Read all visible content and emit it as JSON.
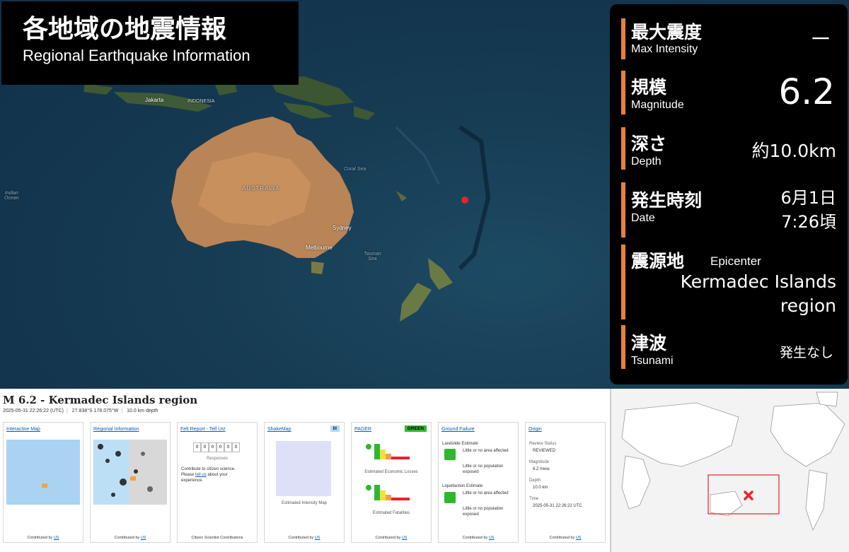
{
  "header": {
    "title_jp": "各地域の地震情報",
    "title_en": "Regional Earthquake Information"
  },
  "map_labels": {
    "jakarta": "Jakarta",
    "indonesia": "INDONESIA",
    "australia": "AUSTRALIA",
    "sydney": "Sydney",
    "melbourne": "Melbourne",
    "indian_ocean": "Indian\nOcean",
    "coral_sea": "Coral Sea",
    "tasman_sea": "Tasman\nSea"
  },
  "info": {
    "intensity": {
      "jp": "最大震度",
      "en": "Max  Intensity",
      "value": "－"
    },
    "magnitude": {
      "jp": "規模",
      "en": "Magnitude",
      "value": "6.2"
    },
    "depth": {
      "jp": "深さ",
      "en": "Depth",
      "value": "約10.0km"
    },
    "date": {
      "jp": "発生時刻",
      "en": "Date",
      "value_line1": "6月1日",
      "value_line2": "7:26頃"
    },
    "epicenter": {
      "jp": "震源地",
      "en": "Epicenter",
      "value_line1": "Kermadec Islands",
      "value_line2": "region"
    },
    "tsunami": {
      "jp": "津波",
      "en": "Tsunami",
      "value": "発生なし"
    }
  },
  "usgs": {
    "title": "M 6.2 - Kermadec Islands region",
    "time": "2025-05-31 22:26:22 (UTC)",
    "location": "27.838°S 178.075°W",
    "depth": "10.0 km depth",
    "contributed_by": "Contributed by",
    "us": "US",
    "cards": {
      "interactive_map": "Interactive Map",
      "regional_info": "Regional Information",
      "felt_report": "Felt Report - Tell Us!",
      "felt_counter": [
        "0",
        "0",
        "0",
        "0",
        "0",
        "0"
      ],
      "responses": "Responses",
      "felt_text_1": "Contribute to citizen science.",
      "felt_text_2": "Please",
      "felt_link": "tell us",
      "felt_text_3": "about your",
      "felt_text_4": "experience.",
      "felt_footer": "Citizen Scientist Contributions",
      "shakemap": "ShakeMap",
      "shakemap_badge": "III",
      "shakemap_caption": "Estimated Intensity Map",
      "pager": "PAGER",
      "pager_badge": "GREEN",
      "pager_econ": "Estimated Economic Losses",
      "pager_fatal": "Estimated Fatalities",
      "ground_failure": "Ground Failure",
      "landslide": "Landslide Estimate",
      "landslide_area": "Little or no area affected",
      "landslide_pop": "Little or no population exposed",
      "liquefaction": "Liquefaction Estimate",
      "liq_area": "Little or no area affected",
      "liq_pop": "Little or no population exposed",
      "origin": "Origin",
      "review_label": "Review Status",
      "review_value": "REVIEWED",
      "mag_label": "Magnitude",
      "mag_value": "6.2 mww",
      "depth_label": "Depth",
      "depth_value": "10.0 km",
      "time_label": "Time",
      "time_value": "2025-05-31 22:26:22 UTC"
    }
  },
  "colors": {
    "accent_orange": "#e8813a",
    "epicenter_red": "#e8222a",
    "pager_green": "#2eb82e",
    "link_blue": "#0b5ca9"
  }
}
